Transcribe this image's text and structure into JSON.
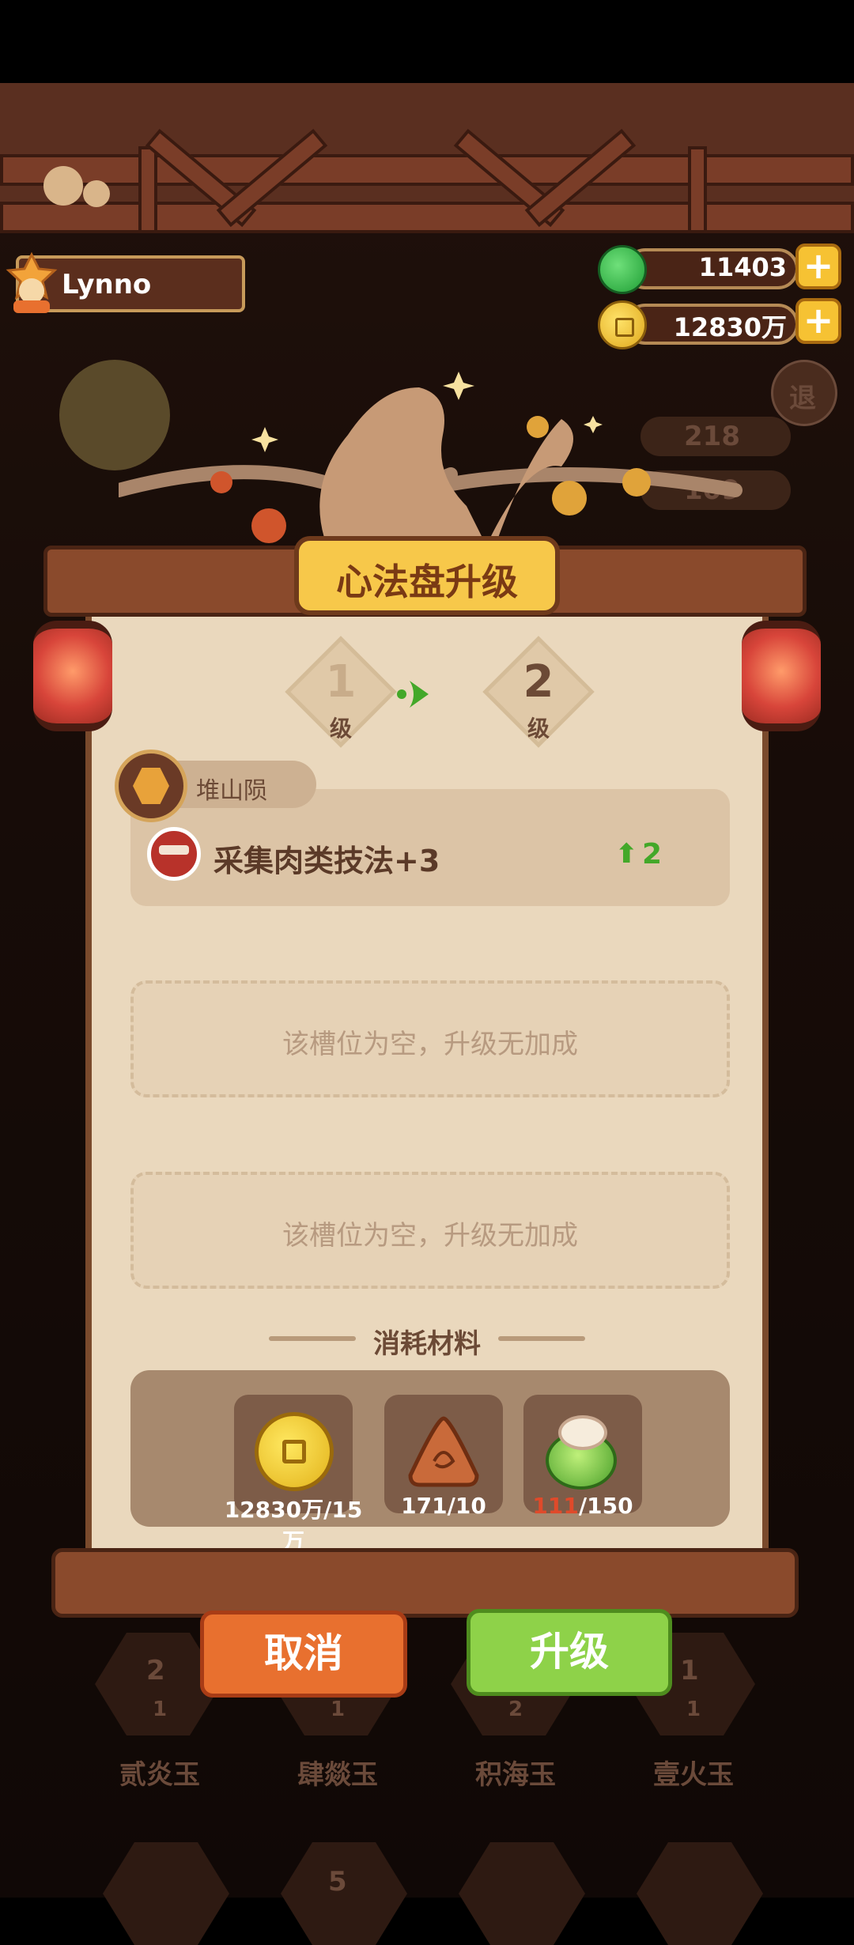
{
  "player": {
    "name": "Lynno"
  },
  "resources": {
    "jade": "11403",
    "coins": "12830万"
  },
  "background": {
    "bottom_slots": [
      {
        "name": "贰炎玉",
        "level": "2",
        "count": "1"
      },
      {
        "name": "肆燚玉",
        "level": "",
        "count": "1"
      },
      {
        "name": "积海玉",
        "level": "",
        "count": "2"
      },
      {
        "name": "壹火玉",
        "level": "1",
        "count": "1"
      }
    ],
    "stats": [
      "218",
      "109"
    ],
    "exit_label": "退",
    "bottom_partial_level": "5"
  },
  "dialog": {
    "title": "心法盘升级",
    "level_from": "1",
    "level_to": "2",
    "level_unit": "级",
    "jade_name": "堆山陨",
    "skill_name": "采集肉类技法+3",
    "skill_level": "2",
    "empty_slot_text": "该槽位为空，升级无加成",
    "materials_title": "消耗材料",
    "materials": [
      {
        "name": "coin-icon",
        "have": "12830万",
        "need": "/15万",
        "insufficient": false
      },
      {
        "name": "rice-dumpling-icon",
        "have": "171",
        "need": "/10",
        "insufficient": false
      },
      {
        "name": "jade-pearl-icon",
        "have": "111",
        "need": "/150",
        "insufficient": true
      }
    ],
    "cancel_label": "取消",
    "upgrade_label": "升级"
  },
  "colors": {
    "insufficient": "#e04a2a",
    "accent_green": "#43a829",
    "accent_orange": "#e8702f"
  }
}
